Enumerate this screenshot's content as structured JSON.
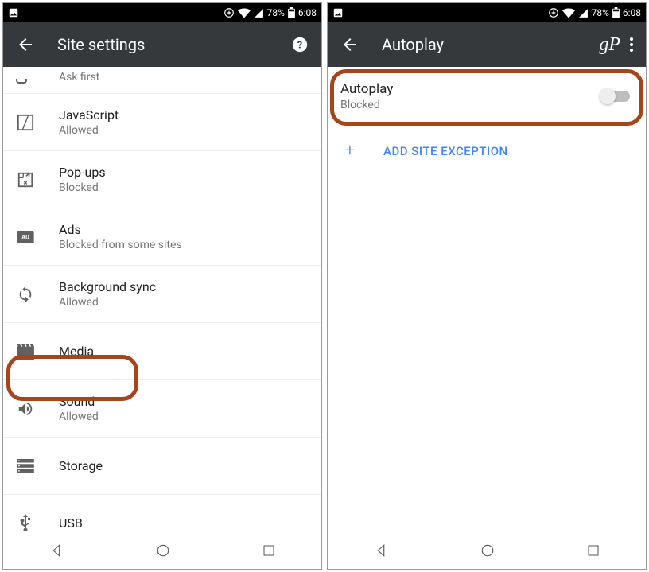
{
  "status": {
    "battery": "78%",
    "time": "6:08"
  },
  "left": {
    "title": "Site settings",
    "partial_sub": "Ask first",
    "items": [
      {
        "label": "JavaScript",
        "sub": "Allowed",
        "icon": "js"
      },
      {
        "label": "Pop-ups",
        "sub": "Blocked",
        "icon": "popup"
      },
      {
        "label": "Ads",
        "sub": "Blocked from some sites",
        "icon": "ads"
      },
      {
        "label": "Background sync",
        "sub": "Allowed",
        "icon": "sync"
      },
      {
        "label": "Media",
        "sub": "",
        "icon": "media"
      },
      {
        "label": "Sound",
        "sub": "Allowed",
        "icon": "sound"
      },
      {
        "label": "Storage",
        "sub": "",
        "icon": "storage"
      },
      {
        "label": "USB",
        "sub": "",
        "icon": "usb"
      }
    ]
  },
  "right": {
    "title": "Autoplay",
    "toggle_label": "Autoplay",
    "toggle_sub": "Blocked",
    "add_label": "ADD SITE EXCEPTION"
  }
}
